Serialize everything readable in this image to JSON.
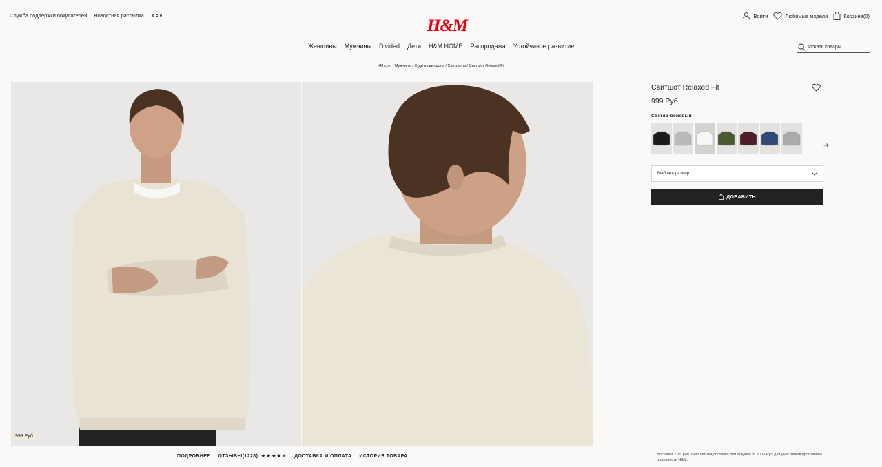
{
  "top_links": [
    "Служба поддержки покупателей",
    "Новостная рассылка"
  ],
  "logo": "H&M",
  "account": {
    "login": "Войти",
    "favorites": "Любимые модели",
    "cart": "Корзина(0)"
  },
  "nav": [
    "Женщины",
    "Мужчины",
    "Divided",
    "Дети",
    "H&M HOME",
    "Распродажа",
    "Устойчивое развитие"
  ],
  "search": {
    "placeholder": "Искать товары"
  },
  "breadcrumb": "HM.com / Мужчины / Худи и свитшоты / Свитшоты / Свитшот Relaxed Fit",
  "gallery": {
    "price_tag": "999 Руб"
  },
  "product": {
    "title": "Свитшот Relaxed Fit",
    "price": "999 Руб",
    "color_name": "Светло-бежевый",
    "swatches": [
      {
        "color": "#1b1b1d"
      },
      {
        "color": "#b9b9ba"
      },
      {
        "color": "#f7f7f6"
      },
      {
        "color": "#4b5a33"
      },
      {
        "color": "#4e1e28"
      },
      {
        "color": "#2f4876"
      },
      {
        "color": "#a9aaab"
      }
    ],
    "size_placeholder": "Выбрать размер",
    "add_label": "ДОБАВИТЬ"
  },
  "bottom_tabs": {
    "details": "ПОДРОБНЕЕ",
    "reviews": "ОТЗЫВЫ(1228)",
    "delivery": "ДОСТАВКА И ОПЛАТА",
    "history": "ИСТОРИЯ ТОВАРА"
  },
  "rating": {
    "value": 4.5,
    "max": 5
  },
  "delivery_note": "Доставка 2-15 раб. Бесплатная доставка при покупке от 2000 Руб для участников программы лояльности H&M."
}
